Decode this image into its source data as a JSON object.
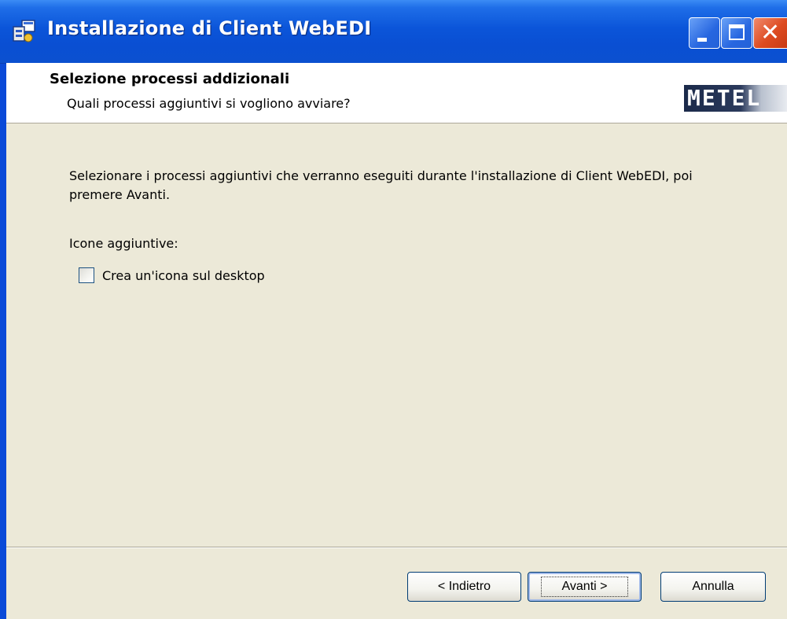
{
  "window": {
    "title": "Installazione di Client WebEDI",
    "controls": {
      "minimize_icon": "minimize-icon",
      "maximize_icon": "maximize-icon",
      "close_icon": "close-icon",
      "close_glyph": "✕"
    }
  },
  "header": {
    "title": "Selezione processi addizionali",
    "subtitle": "Quali processi aggiuntivi si vogliono avviare?",
    "logo_text": "METEL"
  },
  "main": {
    "instructions": "Selezionare i processi aggiuntivi che verranno eseguiti durante l'installazione di Client WebEDI, poi premere Avanti.",
    "group_label": "Icone aggiuntive:",
    "checkbox": {
      "label": "Crea un'icona sul desktop",
      "checked": false
    }
  },
  "footer": {
    "back_label": "< Indietro",
    "next_label": "Avanti >",
    "cancel_label": "Annulla"
  },
  "colors": {
    "titlebar": "#0b55d9",
    "client_bg": "#ece9d8",
    "header_bg": "#ffffff",
    "close_button": "#dd4b21"
  }
}
